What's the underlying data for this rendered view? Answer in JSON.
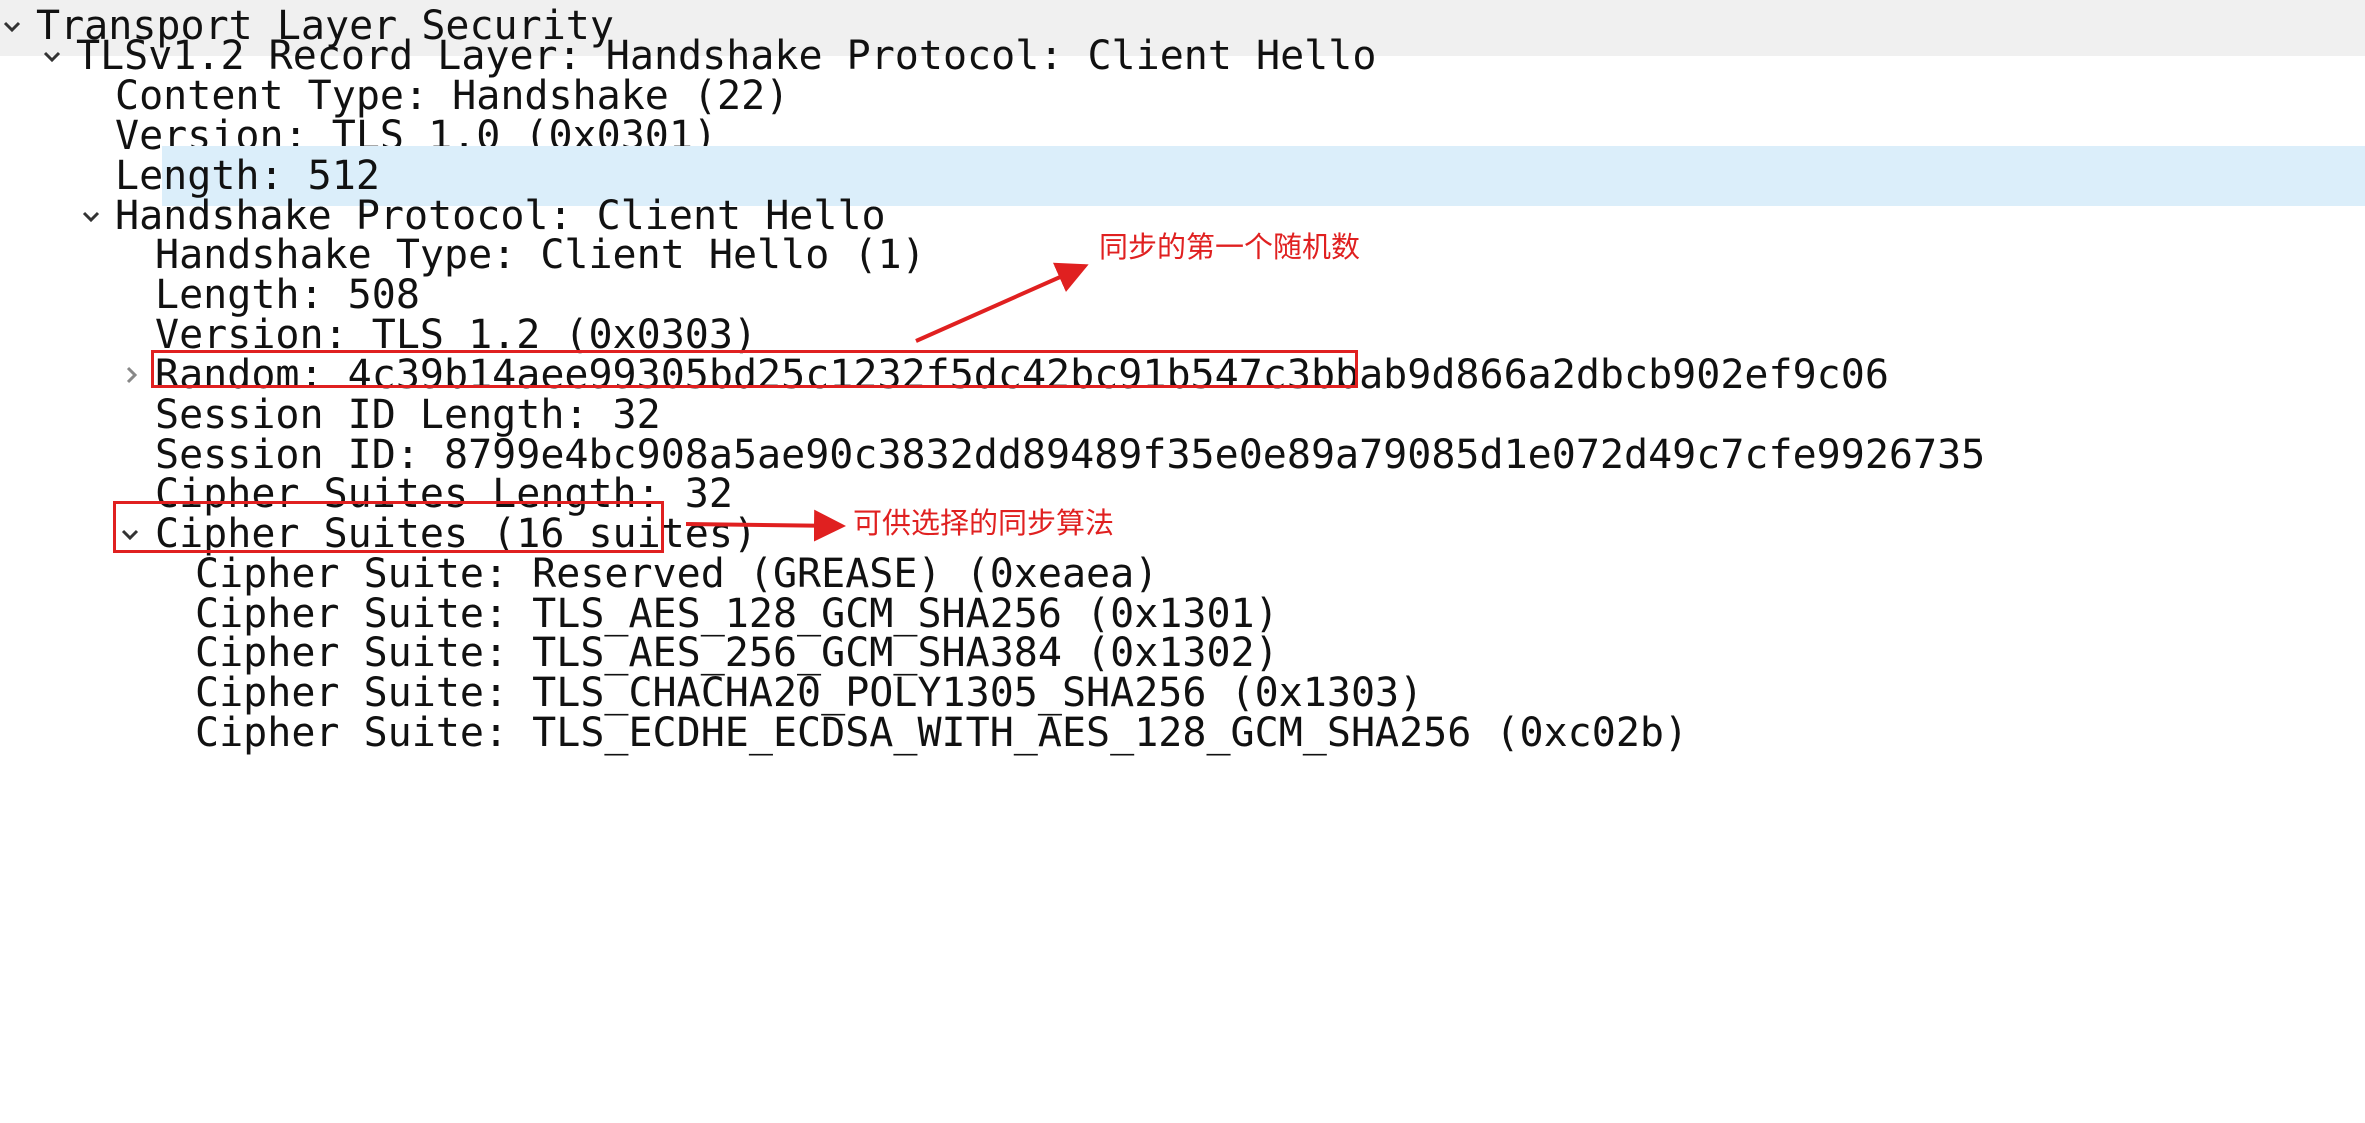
{
  "tree": [
    {
      "label": "Transport Layer Security",
      "expander": "expanded"
    },
    {
      "label": "TLSv1.2 Record Layer: Handshake Protocol: Client Hello",
      "expander": "expanded"
    },
    {
      "label": "Content Type: Handshake (22)",
      "expander": "none"
    },
    {
      "label": "Version: TLS 1.0 (0x0301)",
      "expander": "none"
    },
    {
      "label": "Length: 512",
      "expander": "none",
      "selected": true
    },
    {
      "label": "Handshake Protocol: Client Hello",
      "expander": "expanded"
    },
    {
      "label": "Handshake Type: Client Hello (1)",
      "expander": "none"
    },
    {
      "label": "Length: 508",
      "expander": "none"
    },
    {
      "label": "Version: TLS 1.2 (0x0303)",
      "expander": "none"
    },
    {
      "label": "Random: 4c39b14aee99305bd25c1232f5dc42bc91b547c3bbab9d866a2dbcb902ef9c06",
      "expander": "collapsed"
    },
    {
      "label": "Session ID Length: 32",
      "expander": "none"
    },
    {
      "label": "Session ID: 8799e4bc908a5ae90c3832dd89489f35e0e89a79085d1e072d49c7cfe9926735",
      "expander": "none"
    },
    {
      "label": "Cipher Suites Length: 32",
      "expander": "none"
    },
    {
      "label": "Cipher Suites (16 suites)",
      "expander": "expanded"
    },
    {
      "label": "Cipher Suite: Reserved (GREASE) (0xeaea)",
      "expander": "none"
    },
    {
      "label": "Cipher Suite: TLS_AES_128_GCM_SHA256 (0x1301)",
      "expander": "none"
    },
    {
      "label": "Cipher Suite: TLS_AES_256_GCM_SHA384 (0x1302)",
      "expander": "none"
    },
    {
      "label": "Cipher Suite: TLS_CHACHA20_POLY1305_SHA256 (0x1303)",
      "expander": "none"
    },
    {
      "label": "Cipher Suite: TLS_ECDHE_ECDSA_WITH_AES_128_GCM_SHA256 (0xc02b)",
      "expander": "none"
    }
  ],
  "annotations": {
    "random_note": "同步的第一个随机数",
    "cipher_note": "可供选择的同步算法"
  },
  "colors": {
    "selected_row": "#dbeefa",
    "annotation": "#e02020",
    "top_row": "#f0f0f0"
  }
}
